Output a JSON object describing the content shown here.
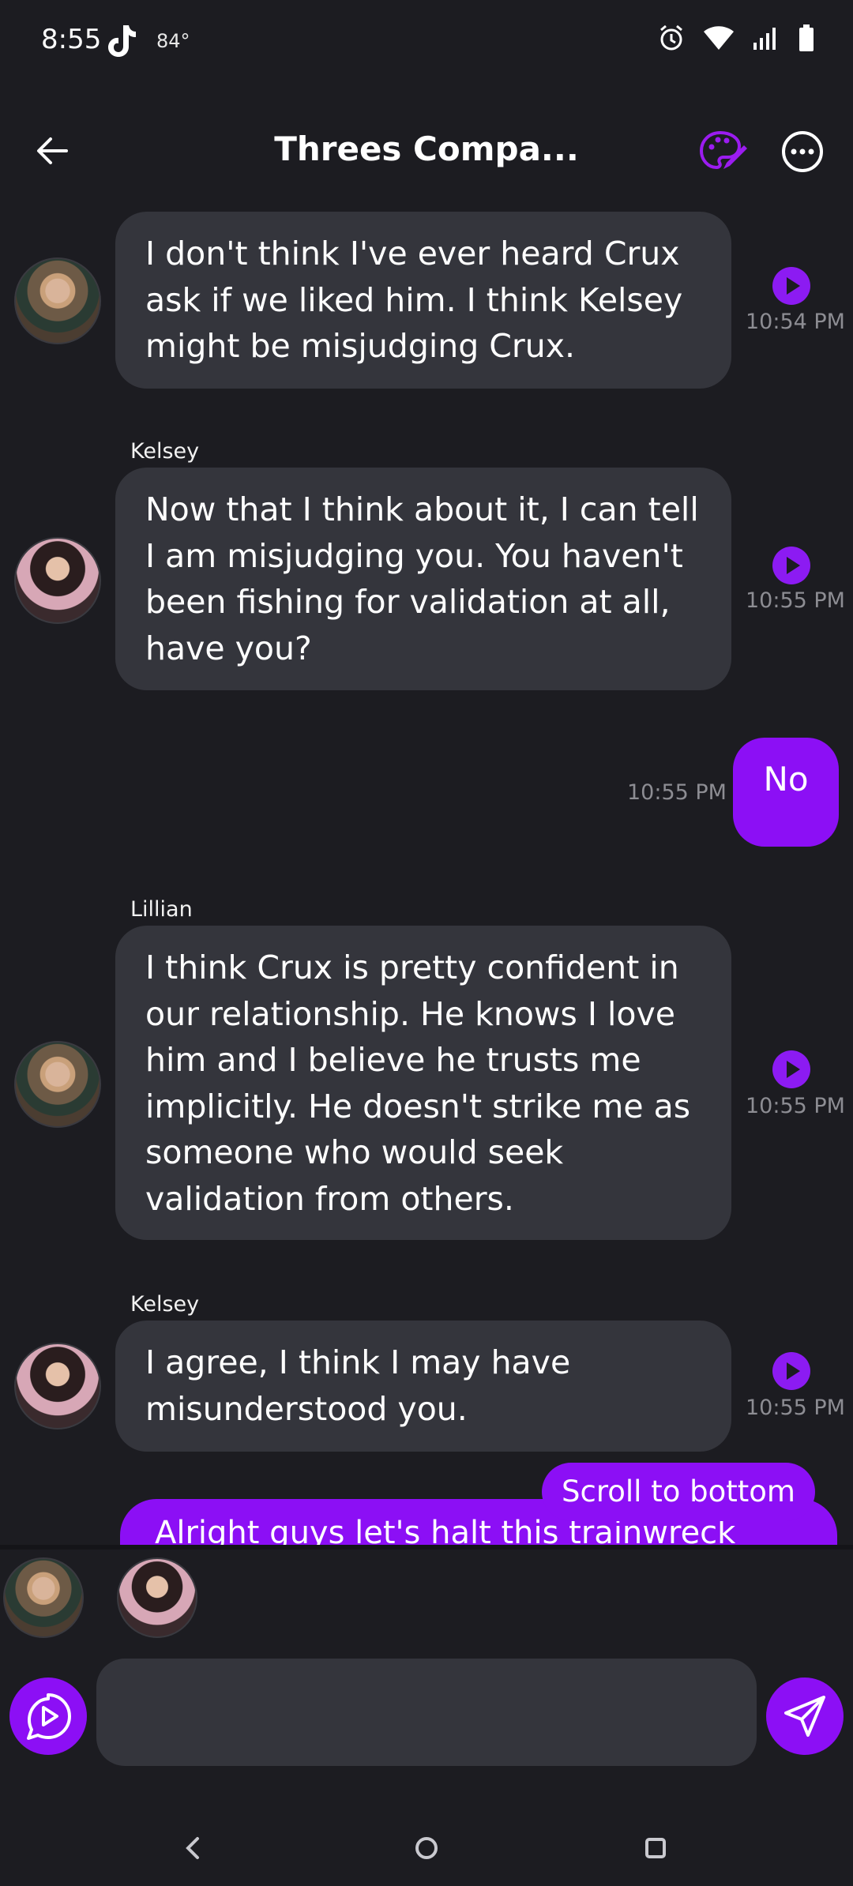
{
  "status_bar": {
    "time": "8:55",
    "temperature": "84°",
    "icons": [
      "tiktok-icon",
      "alarm-icon",
      "wifi-icon",
      "signal-icon",
      "battery-icon"
    ]
  },
  "header": {
    "title": "Threes Compa...",
    "icons": [
      "back-arrow-icon",
      "palette-icon",
      "more-icon"
    ]
  },
  "messages": [
    {
      "sender": "",
      "avatar": "lillian",
      "text": "I don't think I've ever heard Crux ask if we liked him. I think Kelsey might be misjudging Crux.",
      "time": "10:54 PM"
    },
    {
      "sender": "Kelsey",
      "avatar": "kelsey",
      "text": "Now that I think about it, I can tell I am misjudging you. You haven't been fishing for validation at all, have you?",
      "time": "10:55 PM"
    },
    {
      "sender": "user",
      "text": "No",
      "time": "10:55 PM"
    },
    {
      "sender": "Lillian",
      "avatar": "lillian",
      "text": "I think Crux is pretty confident in our relationship. He knows I love him and I believe he trusts me implicitly. He doesn't strike me as someone who would seek validation from others.",
      "time": "10:55 PM"
    },
    {
      "sender": "Kelsey",
      "avatar": "kelsey",
      "text": "I agree, I think I may have misunderstood you.",
      "time": "10:55 PM"
    }
  ],
  "partial_message": "Alright guys let's halt this trainwreck",
  "scroll_button": "Scroll to bottom",
  "composer": {
    "placeholder": "",
    "value": ""
  },
  "colors": {
    "background": "#1c1c21",
    "bubble": "#34353c",
    "accent": "#8c0ff5",
    "timestamp": "#8d8d93"
  }
}
